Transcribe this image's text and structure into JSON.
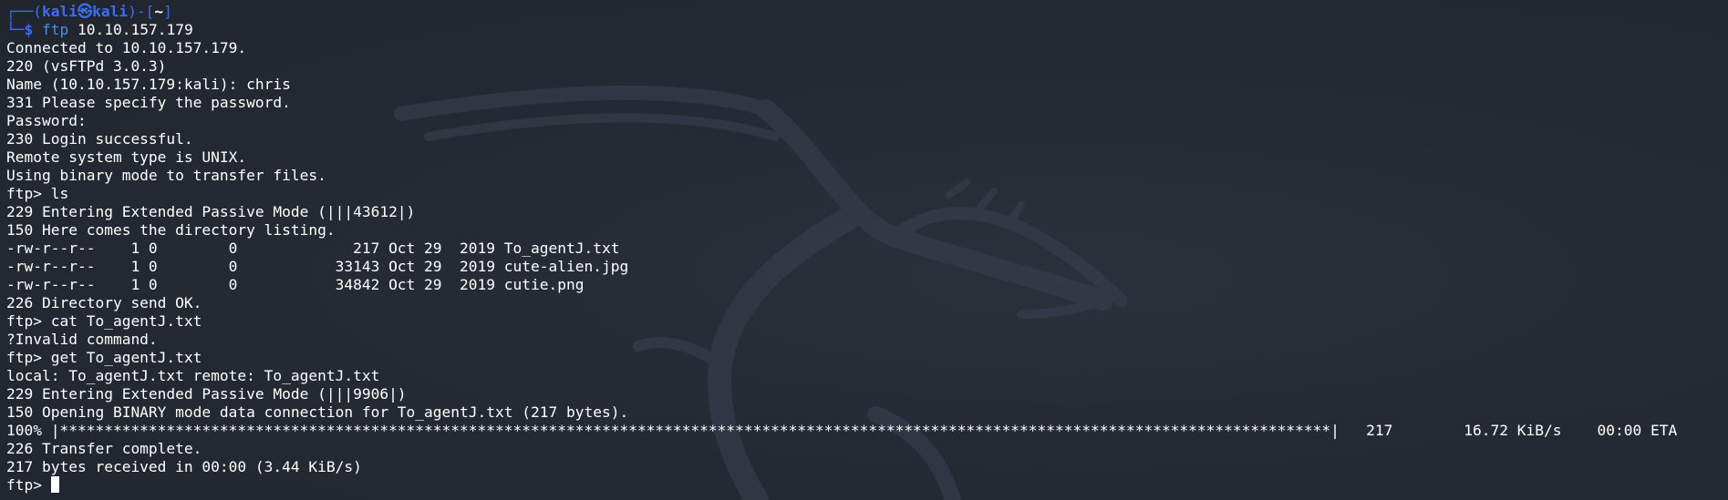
{
  "prompt": {
    "frame_top_left": "┌──(",
    "user": "kali",
    "at_symbol": "㉿",
    "host": "kali",
    "frame_mid": ")-[",
    "path": "~",
    "frame_end": "]",
    "frame_bottom_left": "└─",
    "dollar": "$",
    "command_name": "ftp",
    "command_args": " 10.10.157.179"
  },
  "output_lines": [
    "Connected to 10.10.157.179.",
    "220 (vsFTPd 3.0.3)",
    "Name (10.10.157.179:kali): chris",
    "331 Please specify the password.",
    "Password:",
    "230 Login successful.",
    "Remote system type is UNIX.",
    "Using binary mode to transfer files.",
    "ftp> ls",
    "229 Entering Extended Passive Mode (|||43612|)",
    "150 Here comes the directory listing.",
    "-rw-r--r--    1 0        0             217 Oct 29  2019 To_agentJ.txt",
    "-rw-r--r--    1 0        0           33143 Oct 29  2019 cute-alien.jpg",
    "-rw-r--r--    1 0        0           34842 Oct 29  2019 cutie.png",
    "226 Directory send OK.",
    "ftp> cat To_agentJ.txt",
    "?Invalid command.",
    "ftp> get To_agentJ.txt",
    "local: To_agentJ.txt remote: To_agentJ.txt",
    "229 Entering Extended Passive Mode (|||9906|)",
    "150 Opening BINARY mode data connection for To_agentJ.txt (217 bytes).",
    "100% |***********************************************************************************************************************************************|   217        16.72 KiB/s    00:00 ETA",
    "226 Transfer complete.",
    "217 bytes received in 00:00 (3.44 KiB/s)"
  ],
  "final_prompt": "ftp> ",
  "colors": {
    "background": "#232731",
    "prompt_accent": "#3d6df4",
    "text": "#ffffff"
  },
  "background_icon": "kali-dragon-icon"
}
